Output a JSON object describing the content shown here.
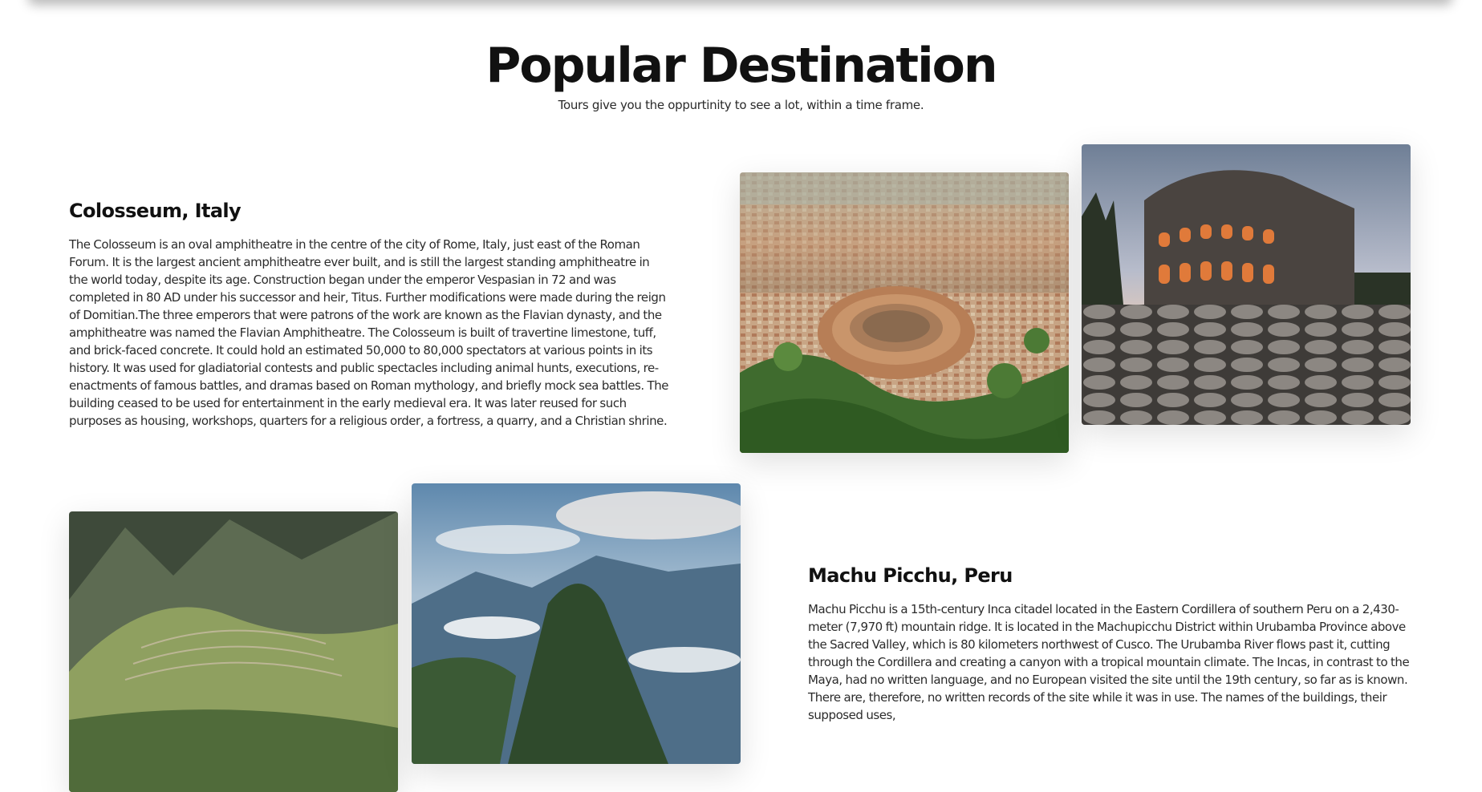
{
  "section": {
    "title": "Popular Destination",
    "subtitle": "Tours give you the oppurtinity to see a lot, within a time frame."
  },
  "destinations": [
    {
      "title": "Colosseum, Italy",
      "description": "The Colosseum is an oval amphitheatre in the centre of the city of Rome, Italy, just east of the Roman Forum. It is the largest ancient amphitheatre ever built, and is still the largest standing amphitheatre in the world today, despite its age. Construction began under the emperor Vespasian in 72 and was completed in 80 AD under his successor and heir, Titus. Further modifications were made during the reign of Domitian.The three emperors that were patrons of the work are known as the Flavian dynasty, and the amphitheatre was named the Flavian Amphitheatre. The Colosseum is built of travertine limestone, tuff, and brick-faced concrete. It could hold an estimated 50,000 to 80,000 spectators at various points in its history. It was used for gladiatorial contests and public spectacles including animal hunts, executions, re-enactments of famous battles, and dramas based on Roman mythology, and briefly mock sea battles. The building ceased to be used for entertainment in the early medieval era. It was later reused for such purposes as housing, workshops, quarters for a religious order, a fortress, a quarry, and a Christian shrine.",
      "images": [
        "colosseum-aerial-photo",
        "colosseum-dusk-photo"
      ]
    },
    {
      "title": "Machu Picchu, Peru",
      "description": "Machu Picchu is a 15th-century Inca citadel located in the Eastern Cordillera of southern Peru on a 2,430-meter (7,970 ft) mountain ridge. It is located in the Machupicchu District within Urubamba Province above the Sacred Valley, which is 80 kilometers northwest of Cusco. The Urubamba River flows past it, cutting through the Cordillera and creating a canyon with a tropical mountain climate. The Incas, in contrast to the Maya, had no written language, and no European visited the site until the 19th century, so far as is known. There are, therefore, no written records of the site while it was in use. The names of the buildings, their supposed uses,",
      "images": [
        "machu-picchu-terraces-photo",
        "huayna-picchu-clouds-photo"
      ]
    }
  ],
  "colors": {
    "background": "#ffffff",
    "heading": "#111111",
    "body_text": "#2b2b2b"
  }
}
